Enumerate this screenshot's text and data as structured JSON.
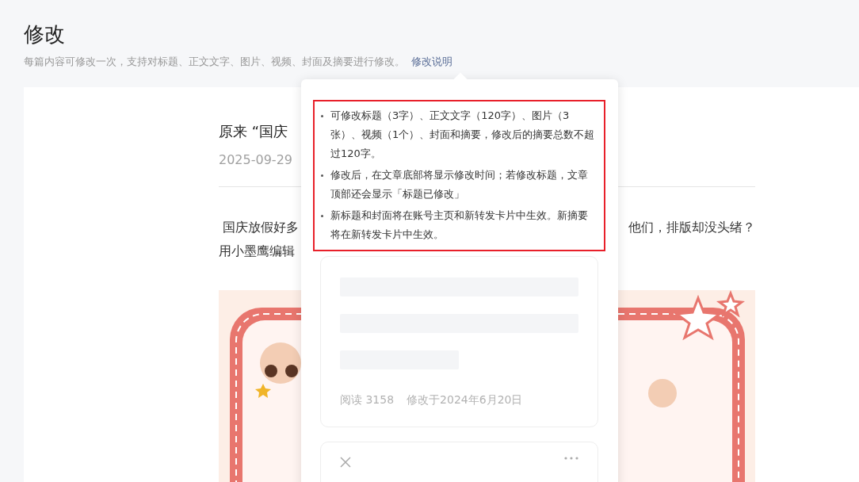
{
  "header": {
    "title": "修改",
    "description": "每篇内容可修改一次，支持对标题、正文文字、图片、视频、封面及摘要进行修改。",
    "help_link": "修改说明"
  },
  "article": {
    "title": "原来 “国庆",
    "date": "2025-09-29",
    "body_lines": [
      {
        "left": " 国庆放假好多",
        "right": "他们，排版却没头绪？"
      },
      {
        "left": "用小墨鹰编辑"
      }
    ]
  },
  "popover": {
    "notes": [
      "可修改标题（3字）、正文文字（120字）、图片（3张）、视频（1个）、封面和摘要，修改后的摘要总数不超过120字。",
      "修改后，在文章底部将显示修改时间；若修改标题，文章顶部还会显示「标题已修改」",
      "新标题和封面将在账号主页和新转发卡片中生效。新摘要将在新转发卡片中生效。"
    ],
    "preview": {
      "reads": "阅读 3158",
      "modified": "修改于2024年6月20日"
    }
  }
}
